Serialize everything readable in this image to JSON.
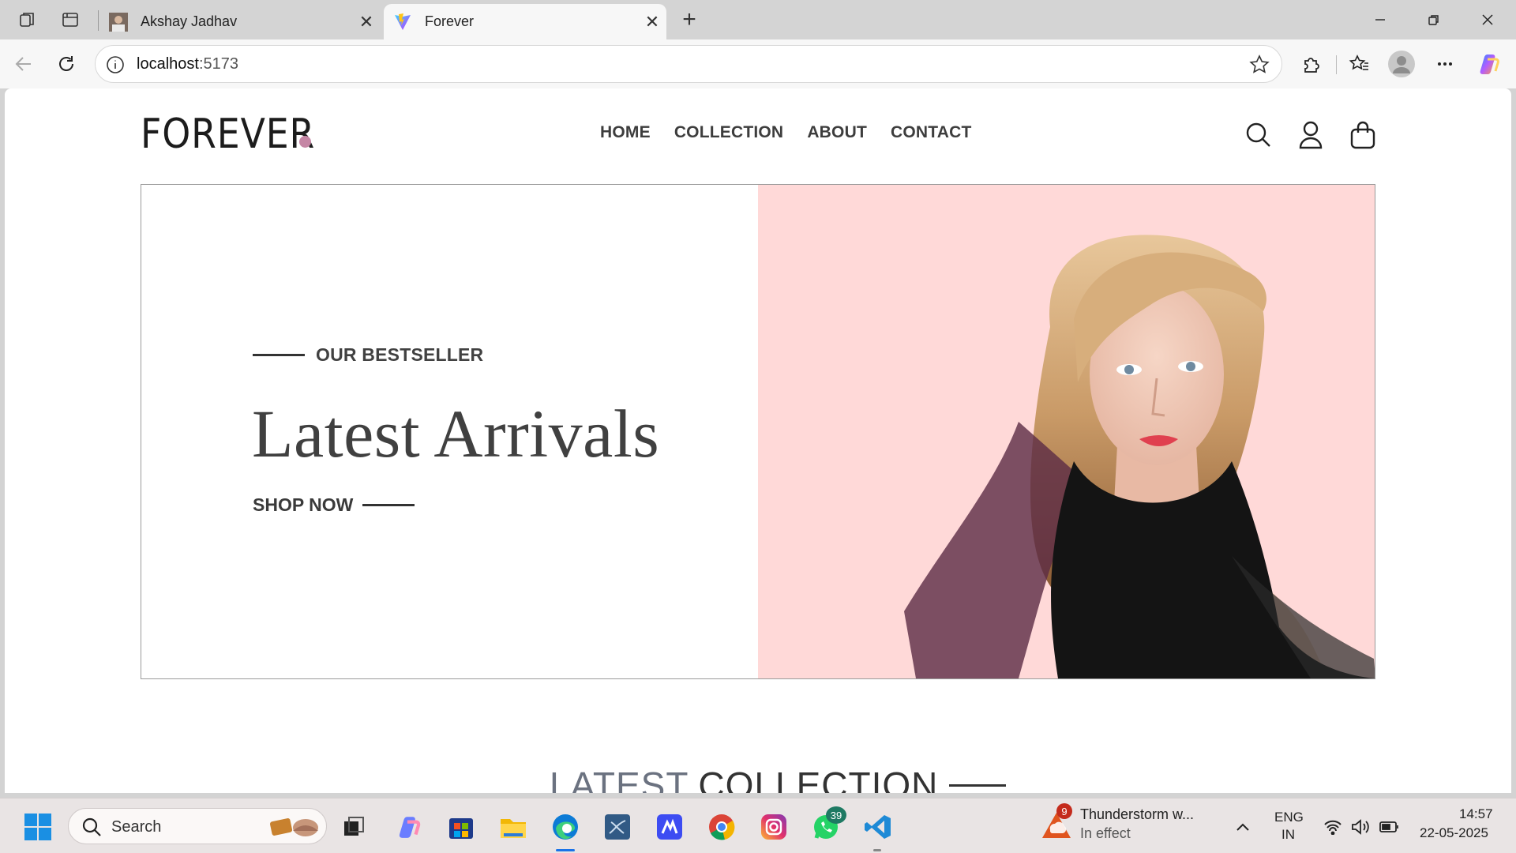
{
  "browser": {
    "tabs": [
      {
        "title": "Akshay Jadhav",
        "active": false
      },
      {
        "title": "Forever",
        "active": true
      }
    ],
    "address": {
      "host": "localhost",
      "port": ":5173"
    }
  },
  "site": {
    "logo": "FOREVER",
    "nav": [
      "HOME",
      "COLLECTION",
      "ABOUT",
      "CONTACT"
    ],
    "hero": {
      "eyebrow": "OUR BESTSELLER",
      "headline": "Latest Arrivals",
      "cta": "SHOP NOW",
      "bg_right": "#ffd9d8"
    },
    "section": {
      "title_light": "LATEST",
      "title_bold": "COLLECTION"
    }
  },
  "taskbar": {
    "search_label": "Search",
    "whatsapp_badge": "39",
    "weather": {
      "badge": "9",
      "title": "Thunderstorm w...",
      "subtitle": "In effect"
    },
    "lang": {
      "line1": "ENG",
      "line2": "IN"
    },
    "clock": {
      "time": "14:57",
      "date": "22-05-2025"
    }
  },
  "colors": {
    "accent": "#c586a5",
    "text": "#414141"
  }
}
